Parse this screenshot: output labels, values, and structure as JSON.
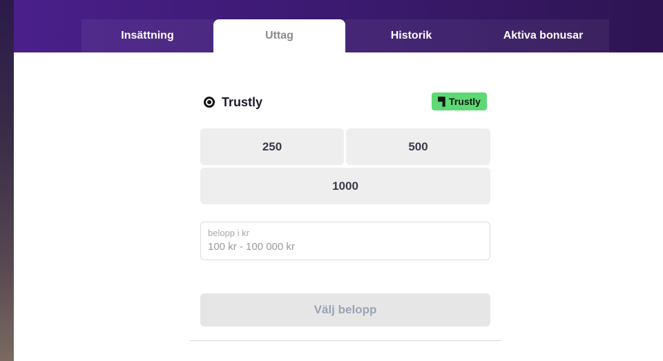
{
  "tabs": [
    {
      "label": "Insättning",
      "active": false
    },
    {
      "label": "Uttag",
      "active": true
    },
    {
      "label": "Historik",
      "active": false
    },
    {
      "label": "Aktiva bonusar",
      "active": false
    }
  ],
  "payment_method": {
    "name": "Trustly",
    "selected": true,
    "logo_text": "Trustly",
    "logo_color": "#5ed975"
  },
  "amount_options": [
    "250",
    "500",
    "1000"
  ],
  "amount_field": {
    "label": "belopp i kr",
    "value": "",
    "placeholder": "100 kr - 100 000 kr"
  },
  "submit": {
    "label": "Välj belopp",
    "disabled": true
  },
  "colors": {
    "header_gradient_start": "#4a1f8a",
    "header_gradient_end": "#2e1452",
    "button_bg": "#eeeeee"
  }
}
